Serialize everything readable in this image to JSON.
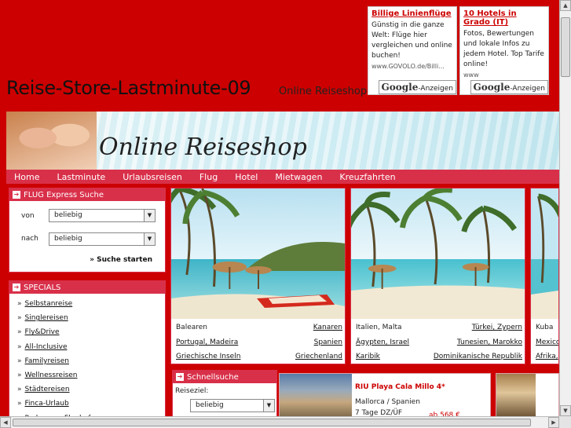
{
  "header": {
    "title": "Reise-Store-Lastminute-09",
    "subtitle": "Online Reiseshop"
  },
  "ads": [
    {
      "title": "Billige Linienflüge",
      "body": "Günstig in die ganze Welt: Flüge hier vergleichen und online buchen!",
      "url": "www.GOVOLO.de/Billi...",
      "badge_brand": "Google",
      "badge_label": "-Anzeigen"
    },
    {
      "title": "10 Hotels in Grado (IT)",
      "body": "Fotos, Bewertungen und lokale Infos zu jedem Hotel. Top Tarife online!",
      "url": "www",
      "badge_brand": "Google",
      "badge_label": "-Anzeigen"
    }
  ],
  "banner": {
    "logo_text": "Online Reiseshop"
  },
  "nav": {
    "items": [
      "Home",
      "Lastminute",
      "Urlaubsreisen",
      "Flug",
      "Hotel",
      "Mietwagen",
      "Kreuzfahrten"
    ]
  },
  "flug_box": {
    "title": "FLUG Express Suche",
    "von_label": "von",
    "von_value": "beliebig",
    "nach_label": "nach",
    "nach_value": "beliebig",
    "search_link": "» Suche starten"
  },
  "specials": {
    "title": "SPECIALS",
    "items": [
      "Selbstanreise",
      "Singlereisen",
      "Fly&Drive",
      "All-Inclusive",
      "Familyreisen",
      "Wellnessreisen",
      "Städtereisen",
      "Finca-Urlaub",
      "Parken am Flughafen"
    ]
  },
  "destinations": [
    {
      "rows": [
        [
          "Balearen",
          "Kanaren"
        ],
        [
          "Portugal, Madeira",
          "Spanien"
        ],
        [
          "Griechische Inseln",
          "Griechenland"
        ]
      ]
    },
    {
      "rows": [
        [
          "Italien, Malta",
          "Türkei, Zypern"
        ],
        [
          "Ägypten, Israel",
          "Tunesien, Marokko"
        ],
        [
          "Karibik",
          "Dominikanische Republik"
        ]
      ]
    },
    {
      "rows": [
        [
          "Kuba",
          ""
        ],
        [
          "Mexico",
          ""
        ],
        [
          "Afrika,",
          ""
        ]
      ]
    }
  ],
  "quick_search": {
    "title": "Schnellsuche",
    "label": "Reiseziel:",
    "value": "beliebig"
  },
  "hotel_offer": {
    "name": "RIU Playa Cala Millo 4*",
    "location": "Mallorca / Spanien",
    "duration": "7 Tage DZ/ÜF",
    "price": "ab 568 €"
  },
  "colors": {
    "page_bg": "#cc0000",
    "accent": "#d9304a"
  }
}
